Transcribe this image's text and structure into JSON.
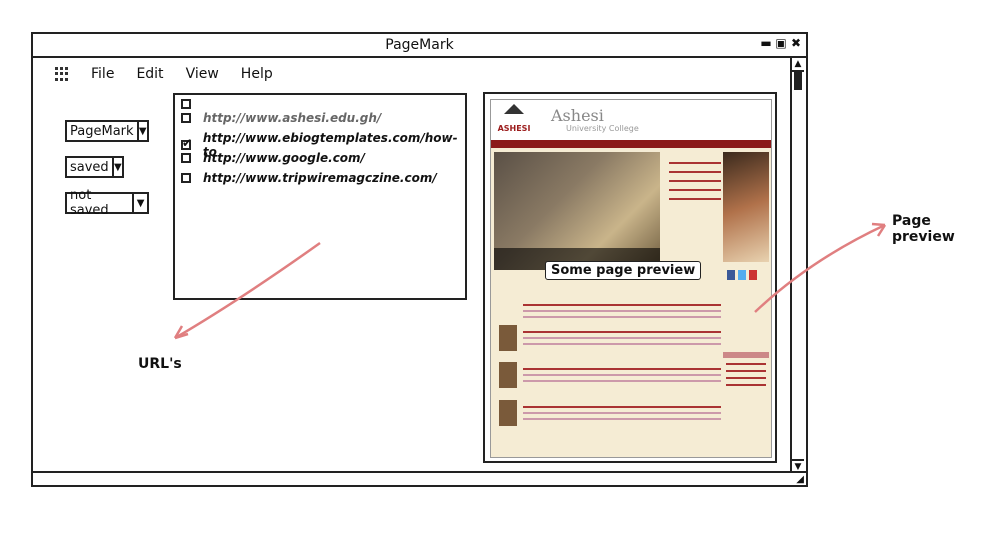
{
  "window": {
    "title": "PageMark"
  },
  "menu": {
    "items": [
      "File",
      "Edit",
      "View",
      "Help"
    ]
  },
  "dropdowns": [
    {
      "label": "PageMark"
    },
    {
      "label": "saved"
    },
    {
      "label": "not saved"
    }
  ],
  "urls": [
    {
      "text": "http://www.ashesi.edu.gh/",
      "checked": true,
      "dim": true
    },
    {
      "text": "http://www.ebiogtemplates.com/how-to",
      "checked": true,
      "dim": false
    },
    {
      "text": "http://www.google.com/",
      "checked": false,
      "dim": false
    },
    {
      "text": "http://www.tripwiremagczine.com/",
      "checked": false,
      "dim": false
    }
  ],
  "preview": {
    "tooltip": "Some page preview",
    "site_name": "Ashesi",
    "site_sub": "University College",
    "logo_text": "ASHESI"
  },
  "annotations": {
    "urls": "URL's",
    "preview": "Page preview"
  },
  "colors": {
    "arrow": "#e07f80",
    "site_brand": "#8b1a1a"
  }
}
